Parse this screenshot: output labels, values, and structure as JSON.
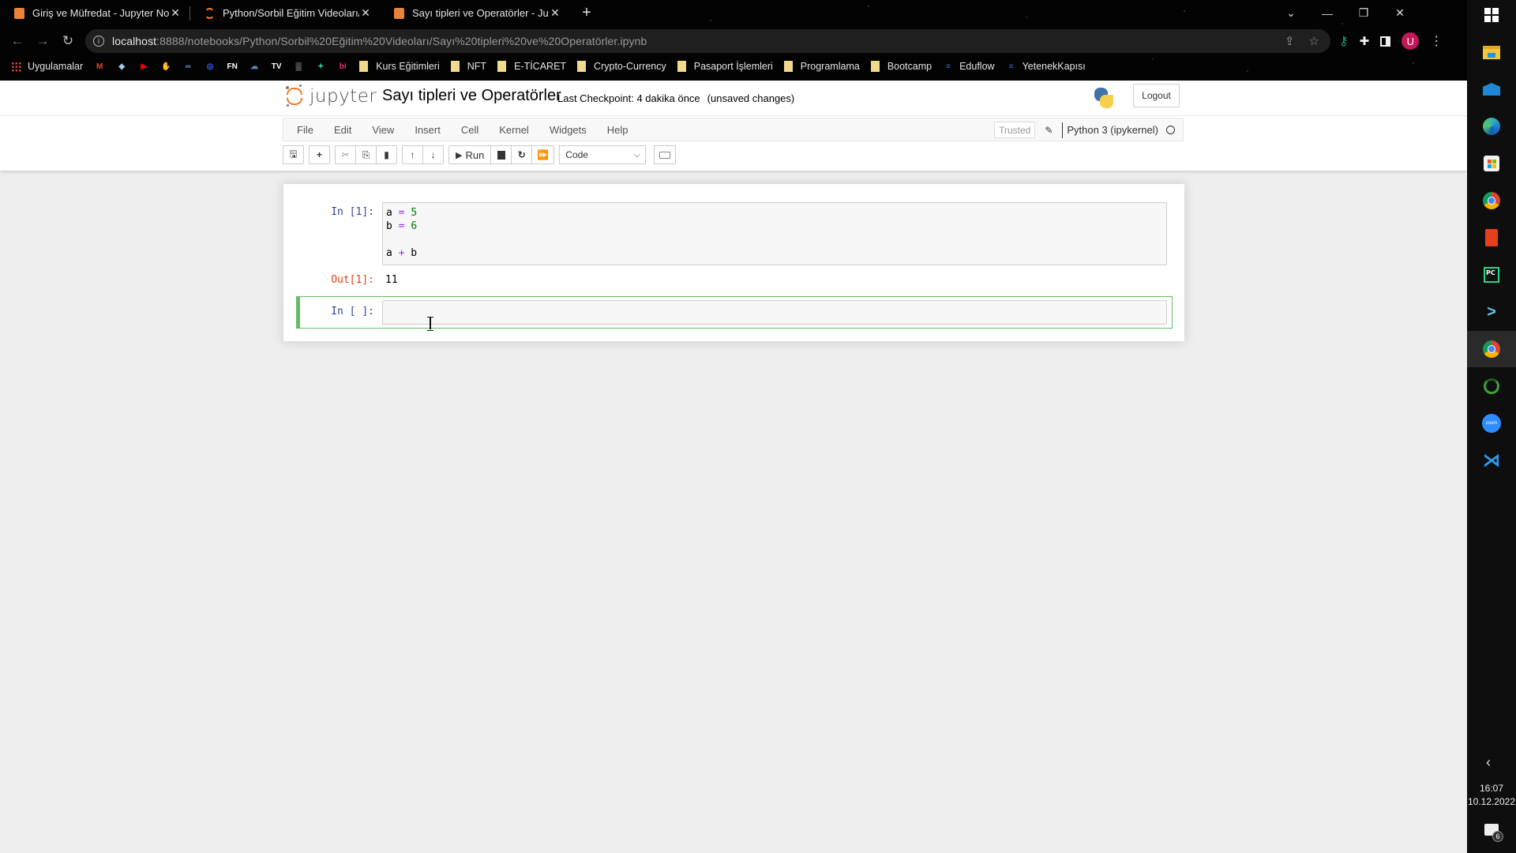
{
  "browser": {
    "tabs": [
      {
        "title": "Giriş ve Müfredat - Jupyter Notel",
        "icon": "notebook-book-icon",
        "active": false
      },
      {
        "title": "Python/Sorbil Eğitim Videoları/",
        "icon": "jupyter-loading-icon",
        "active": false
      },
      {
        "title": "Sayı tipleri ve Operatörler - Jupyt",
        "icon": "notebook-book-icon",
        "active": true
      }
    ],
    "tab_close_glyph": "✕",
    "new_tab_glyph": "+",
    "window_controls": {
      "dropdown": "⌄",
      "minimize": "—",
      "restore": "❐",
      "close": "✕"
    },
    "url_host": "localhost",
    "url_rest": ":8888/notebooks/Python/Sorbil%20Eğitim%20Videoları/Sayı%20tipleri%20ve%20Operatörler.ipynb",
    "profile_initial": "U",
    "bookmarks": [
      {
        "label": "Uygulamalar",
        "icon": "apps-grid-icon"
      },
      {
        "label": "",
        "icon": "gmail-icon",
        "glyph": "M",
        "color": "#ea4335"
      },
      {
        "label": "",
        "icon": "bookmark-cube-icon",
        "glyph": "◆",
        "color": "#9ecbe8"
      },
      {
        "label": "",
        "icon": "youtube-icon",
        "glyph": "▶",
        "color": "#ff0000"
      },
      {
        "label": "",
        "icon": "bookmark-hand-icon",
        "glyph": "✋",
        "color": "#e8c547"
      },
      {
        "label": "",
        "icon": "bookmark-link-icon",
        "glyph": "∞",
        "color": "#6f8fd6"
      },
      {
        "label": "",
        "icon": "coinmarketcap-icon",
        "glyph": "◎",
        "color": "#3861fb"
      },
      {
        "label": "",
        "icon": "bookmark-fn-icon",
        "glyph": "FN",
        "color": "#ffffff"
      },
      {
        "label": "",
        "icon": "bookmark-cloud-icon",
        "glyph": "☁",
        "color": "#5b8fc7"
      },
      {
        "label": "",
        "icon": "tradingview-icon",
        "glyph": "TV",
        "color": "#ffffff"
      },
      {
        "label": "",
        "icon": "bookmark-ghost-icon",
        "glyph": "▓",
        "color": "#555555"
      },
      {
        "label": "",
        "icon": "bookmark-diamond-icon",
        "glyph": "✦",
        "color": "#19c39c"
      },
      {
        "label": "",
        "icon": "bionluk-icon",
        "glyph": "bi",
        "color": "#e8336d"
      },
      {
        "label": "Kurs Eğitimleri",
        "icon": "folder-icon"
      },
      {
        "label": "NFT",
        "icon": "folder-icon"
      },
      {
        "label": "E-TİCARET",
        "icon": "folder-icon"
      },
      {
        "label": "Crypto-Currency",
        "icon": "folder-icon"
      },
      {
        "label": "Pasaport İşlemleri",
        "icon": "folder-icon"
      },
      {
        "label": "Programlama",
        "icon": "folder-icon"
      },
      {
        "label": "Bootcamp",
        "icon": "folder-icon"
      },
      {
        "label": "Eduflow",
        "icon": "eduflow-icon"
      },
      {
        "label": "YetenekKapısı",
        "icon": "yetenekkapisi-icon"
      }
    ]
  },
  "jupyter": {
    "logo_text": "jupyter",
    "notebook_title": "Sayı tipleri ve Operatörler",
    "checkpoint": "Last Checkpoint: 4 dakika önce",
    "unsaved": "(unsaved changes)",
    "logout_label": "Logout",
    "menu": [
      "File",
      "Edit",
      "View",
      "Insert",
      "Cell",
      "Kernel",
      "Widgets",
      "Help"
    ],
    "trusted_label": "Trusted",
    "kernel_name": "Python 3 (ipykernel)",
    "toolbar": {
      "run_label": "Run",
      "cell_type": "Code"
    },
    "cells": [
      {
        "prompt_in": "In [1]:",
        "code_lines": [
          [
            {
              "t": "a "
            },
            {
              "t": "=",
              "c": "op"
            },
            {
              "t": " "
            },
            {
              "t": "5",
              "c": "num"
            }
          ],
          [
            {
              "t": "b "
            },
            {
              "t": "=",
              "c": "op"
            },
            {
              "t": " "
            },
            {
              "t": "6",
              "c": "num"
            }
          ],
          [
            {
              "t": ""
            }
          ],
          [
            {
              "t": "a "
            },
            {
              "t": "+",
              "c": "op"
            },
            {
              "t": " b"
            }
          ]
        ],
        "prompt_out": "Out[1]:",
        "output": "11"
      },
      {
        "prompt_in": "In [ ]:",
        "code_lines": [],
        "selected": true,
        "mode": "edit"
      }
    ]
  },
  "taskbar": {
    "apps": [
      "start-windows-icon",
      "file-explorer-icon",
      "mail-icon",
      "edge-icon",
      "store-icon",
      "chrome-icon",
      "office-icon",
      "pycharm-icon",
      "powerautomate-icon",
      "chrome-icon",
      "green-ring-app-icon",
      "zoom-icon",
      "vscode-icon"
    ],
    "time": "16:07",
    "date": "10.12.2022",
    "notification_count": "6"
  }
}
